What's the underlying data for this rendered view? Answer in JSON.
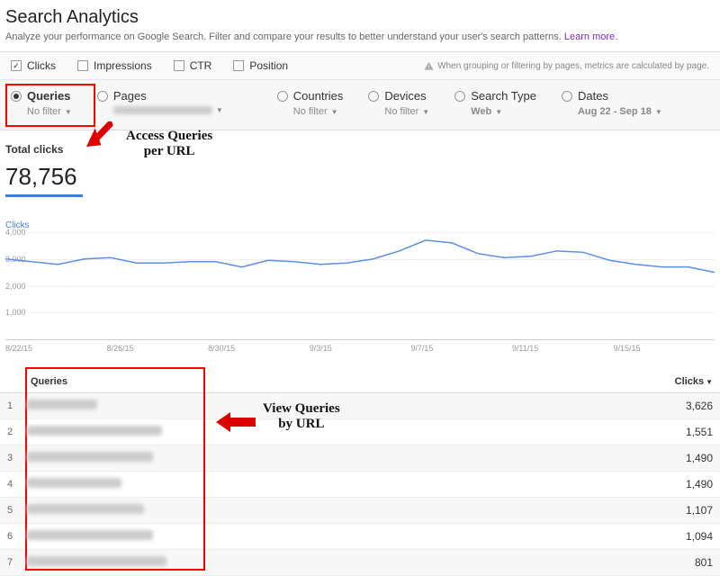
{
  "header": {
    "title": "Search Analytics",
    "subtitle_pre": "Analyze your performance on Google Search. Filter and compare your results to better understand your user's search patterns. ",
    "learn_more": "Learn more"
  },
  "metrics": {
    "clicks": "Clicks",
    "impressions": "Impressions",
    "ctr": "CTR",
    "position": "Position"
  },
  "warning_text": "When grouping or filtering by pages, metrics are calculated by page.",
  "dimensions": {
    "queries": {
      "label": "Queries",
      "sub": "No filter"
    },
    "pages": {
      "label": "Pages",
      "sub": "[redacted]"
    },
    "countries": {
      "label": "Countries",
      "sub": "No filter"
    },
    "devices": {
      "label": "Devices",
      "sub": "No filter"
    },
    "search": {
      "label": "Search Type",
      "sub": "Web"
    },
    "dates": {
      "label": "Dates",
      "sub": "Aug 22 - Sep 18"
    }
  },
  "annotations": {
    "a1": "Access Queries\nper URL",
    "a2": "View Queries\nby URL"
  },
  "totals": {
    "label": "Total clicks",
    "value": "78,756"
  },
  "chart_data": {
    "type": "line",
    "title": "Clicks",
    "xlabel": "",
    "ylabel": "",
    "ylim": [
      0,
      4000
    ],
    "yticks": [
      1000,
      2000,
      3000,
      4000
    ],
    "categories": [
      "8/22/15",
      "8/26/15",
      "8/30/15",
      "9/3/15",
      "9/7/15",
      "9/11/15",
      "9/15/15"
    ],
    "series": [
      {
        "name": "Clicks",
        "values": [
          3000,
          2900,
          2800,
          3000,
          3050,
          2850,
          2850,
          2900,
          2900,
          2700,
          2950,
          2900,
          2800,
          2850,
          3000,
          3300,
          3700,
          3600,
          3200,
          3050,
          3100,
          3300,
          3250,
          2950,
          2800,
          2700,
          2700,
          2500
        ]
      }
    ]
  },
  "table": {
    "col_queries": "Queries",
    "col_clicks": "Clicks",
    "sort_icon": "▼",
    "rows": [
      {
        "n": "1",
        "blur_w": 78,
        "clicks": "3,626"
      },
      {
        "n": "2",
        "blur_w": 150,
        "clicks": "1,551"
      },
      {
        "n": "3",
        "blur_w": 140,
        "clicks": "1,490"
      },
      {
        "n": "4",
        "blur_w": 105,
        "clicks": "1,490"
      },
      {
        "n": "5",
        "blur_w": 130,
        "clicks": "1,107"
      },
      {
        "n": "6",
        "blur_w": 140,
        "clicks": "1,094"
      },
      {
        "n": "7",
        "blur_w": 155,
        "clicks": "801"
      }
    ]
  }
}
